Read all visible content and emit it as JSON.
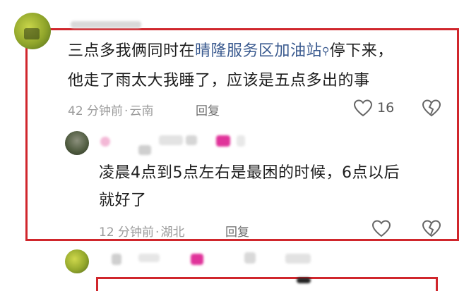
{
  "comment_main": {
    "line1_prefix": "三点多我俩同时在",
    "line1_link": "晴隆服务区加油站",
    "line1_suffix": "停下来，",
    "line2": "他走了雨太大我睡了，应该是五点多出的事",
    "time": "42 分钟前",
    "location": "云南",
    "reply_label": "回复",
    "like_count": "16"
  },
  "reply_1": {
    "line1": "凌晨4点到5点左右是最困的时候，6点以后",
    "line2": "就好了",
    "time": "12 分钟前",
    "location": "湖北",
    "reply_label": "回复"
  },
  "colors": {
    "frame_red": "#d0262c",
    "link_blue": "#3a5a8f",
    "meta_gray": "#9a9a9a"
  }
}
